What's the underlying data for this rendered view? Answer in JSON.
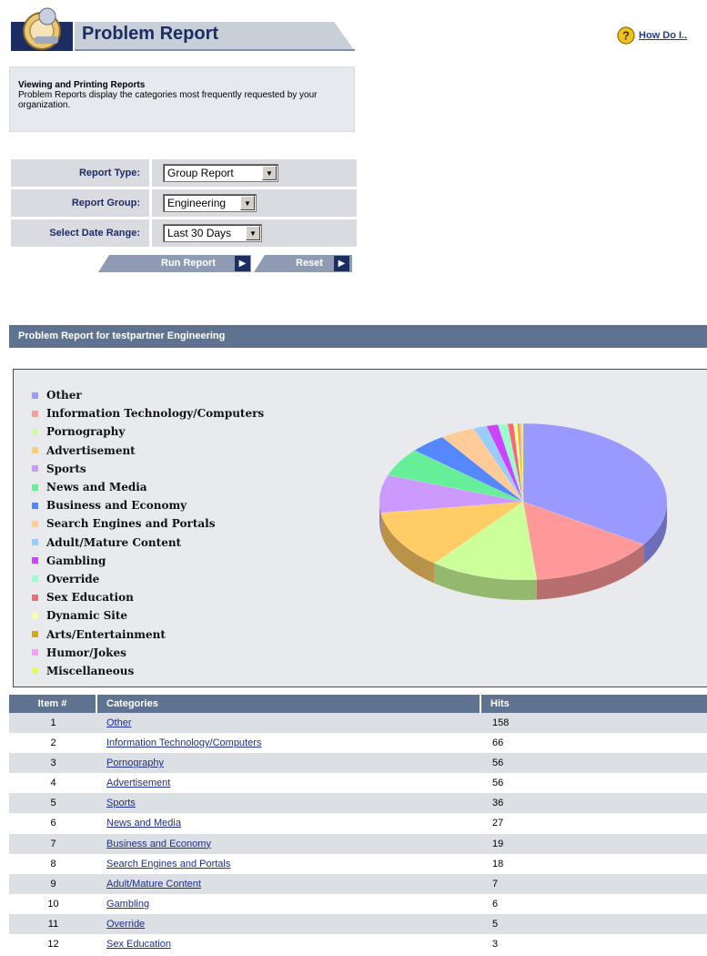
{
  "header": {
    "title": "Problem Report",
    "how_do_i": "How Do I.."
  },
  "info": {
    "heading": "Viewing and Printing Reports",
    "body": "Problem Reports display the categories most frequently requested by your organization."
  },
  "form": {
    "report_type": {
      "label": "Report Type:",
      "value": "Group Report"
    },
    "report_group": {
      "label": "Report Group:",
      "value": "Engineering"
    },
    "date_range": {
      "label": "Select Date Range:",
      "value": "Last 30 Days"
    }
  },
  "buttons": {
    "run_report": "Run Report",
    "reset": "Reset"
  },
  "report": {
    "banner": "Problem Report for testpartner Engineering"
  },
  "legend": [
    {
      "label": "Other",
      "color": "#9999ff"
    },
    {
      "label": "Information Technology/Computers",
      "color": "#ff9999"
    },
    {
      "label": "Pornography",
      "color": "#ccff99"
    },
    {
      "label": "Advertisement",
      "color": "#ffcc66"
    },
    {
      "label": "Sports",
      "color": "#cc99ff"
    },
    {
      "label": "News and Media",
      "color": "#66ee99"
    },
    {
      "label": "Business and Economy",
      "color": "#5588ff"
    },
    {
      "label": "Search Engines and Portals",
      "color": "#ffcc99"
    },
    {
      "label": "Adult/Mature Content",
      "color": "#99ccff"
    },
    {
      "label": "Gambling",
      "color": "#cc44ff"
    },
    {
      "label": "Override",
      "color": "#99ffcc"
    },
    {
      "label": "Sex Education",
      "color": "#ff6677"
    },
    {
      "label": "Dynamic Site",
      "color": "#ffff99"
    },
    {
      "label": "Arts/Entertainment",
      "color": "#ddaa00"
    },
    {
      "label": "Humor/Jokes",
      "color": "#ff99ff"
    },
    {
      "label": "Miscellaneous",
      "color": "#ddff55"
    }
  ],
  "table": {
    "headers": {
      "item": "Item #",
      "categories": "Categories",
      "hits": "Hits"
    },
    "rows": [
      {
        "item": "1",
        "category": "Other",
        "hits": "158"
      },
      {
        "item": "2",
        "category": "Information Technology/Computers",
        "hits": "66"
      },
      {
        "item": "3",
        "category": "Pornography",
        "hits": "56"
      },
      {
        "item": "4",
        "category": "Advertisement",
        "hits": "56"
      },
      {
        "item": "5",
        "category": "Sports",
        "hits": "36"
      },
      {
        "item": "6",
        "category": "News and Media",
        "hits": "27"
      },
      {
        "item": "7",
        "category": "Business and Economy",
        "hits": "19"
      },
      {
        "item": "8",
        "category": "Search Engines and Portals",
        "hits": "18"
      },
      {
        "item": "9",
        "category": "Adult/Mature Content",
        "hits": "7"
      },
      {
        "item": "10",
        "category": "Gambling",
        "hits": "6"
      },
      {
        "item": "11",
        "category": "Override",
        "hits": "5"
      },
      {
        "item": "12",
        "category": "Sex Education",
        "hits": "3"
      }
    ]
  },
  "chart_data": {
    "type": "pie",
    "categories": [
      "Other",
      "Information Technology/Computers",
      "Pornography",
      "Advertisement",
      "Sports",
      "News and Media",
      "Business and Economy",
      "Search Engines and Portals",
      "Adult/Mature Content",
      "Gambling",
      "Override",
      "Sex Education",
      "Dynamic Site",
      "Arts/Entertainment",
      "Humor/Jokes",
      "Miscellaneous"
    ],
    "values": [
      158,
      66,
      56,
      56,
      36,
      27,
      19,
      18,
      7,
      6,
      5,
      3,
      2,
      1,
      1,
      1
    ],
    "colors": [
      "#9999ff",
      "#ff9999",
      "#ccff99",
      "#ffcc66",
      "#cc99ff",
      "#66ee99",
      "#5588ff",
      "#ffcc99",
      "#99ccff",
      "#cc44ff",
      "#99ffcc",
      "#ff6677",
      "#ffff99",
      "#ddaa00",
      "#ff99ff",
      "#ddff55"
    ],
    "title": "",
    "legend_position": "left"
  }
}
